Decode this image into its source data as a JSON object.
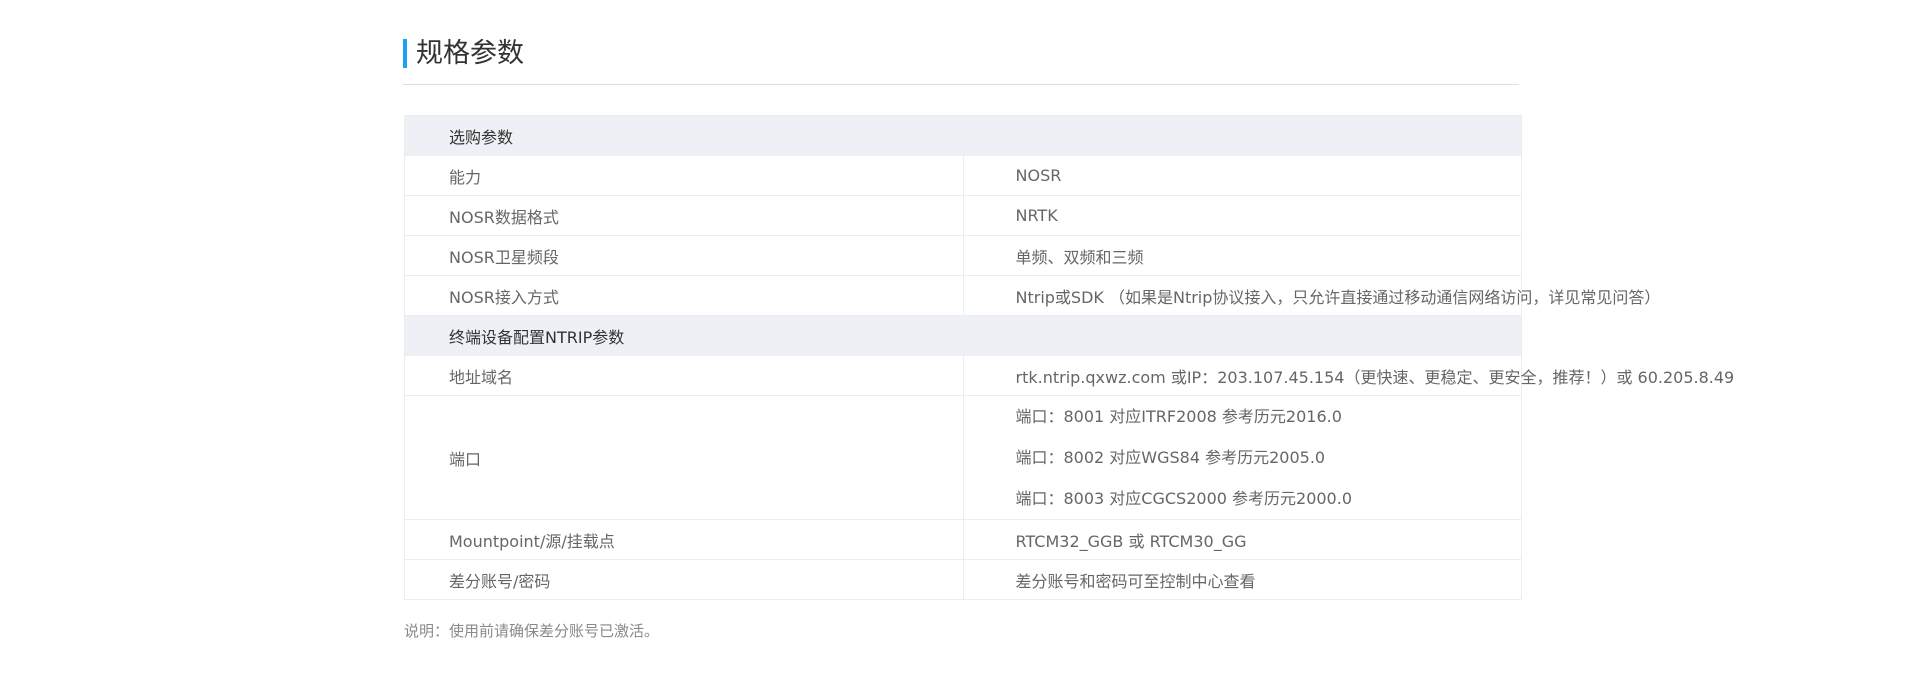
{
  "section": {
    "title": "规格参数",
    "accent_color": "#1aa1f2"
  },
  "table": {
    "groups": [
      {
        "heading": "选购参数",
        "rows": [
          {
            "label": "能力",
            "value": "NOSR"
          },
          {
            "label": "NOSR数据格式",
            "value": "NRTK"
          },
          {
            "label": "NOSR卫星频段",
            "value": "单频、双频和三频"
          },
          {
            "label": "NOSR接入方式",
            "value": "Ntrip或SDK （如果是Ntrip协议接入，只允许直接通过移动通信网络访问，详见常见问答）"
          }
        ]
      },
      {
        "heading": "终端设备配置NTRIP参数",
        "rows": [
          {
            "label": "地址域名",
            "value": "rtk.ntrip.qxwz.com 或IP：203.107.45.154（更快速、更稳定、更安全，推荐！）或 60.205.8.49"
          },
          {
            "label": "端口",
            "lines": [
              "端口：8001 对应ITRF2008  参考历元2016.0",
              "端口：8002 对应WGS84  参考历元2005.0",
              "端口：8003 对应CGCS2000  参考历元2000.0"
            ]
          },
          {
            "label": "Mountpoint/源/挂载点",
            "value": "RTCM32_GGB 或 RTCM30_GG"
          },
          {
            "label": "差分账号/密码",
            "value": "差分账号和密码可至控制中心查看"
          }
        ]
      }
    ]
  },
  "note": "说明：使用前请确保差分账号已激活。"
}
